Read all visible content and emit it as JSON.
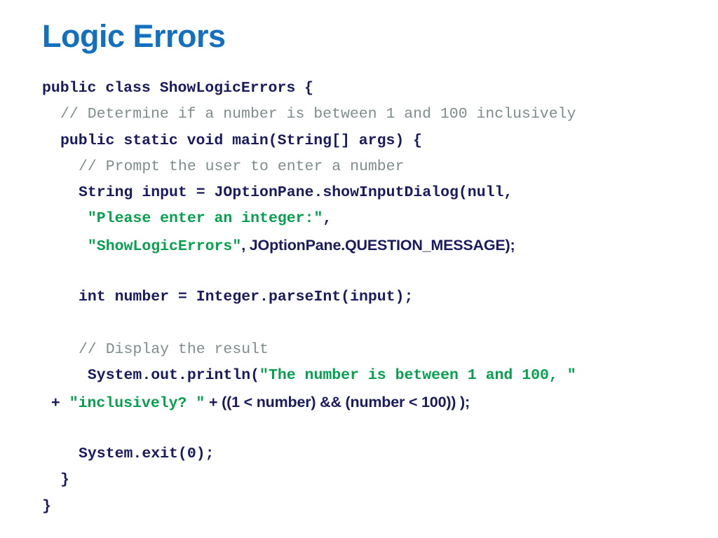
{
  "slide": {
    "title": "Logic Errors",
    "title_color": "#1270BE",
    "background_color": "#ffffff"
  },
  "colors": {
    "code": "#1A1A5E",
    "comment": "#7F8C8D",
    "string": "#06A04F",
    "title": "#1270BE"
  },
  "code": {
    "language": "java",
    "lines": [
      {
        "indent": 0,
        "tokens": [
          {
            "kind": "code",
            "text": "public class ShowLogicErrors {"
          }
        ]
      },
      {
        "indent": 1,
        "tokens": [
          {
            "kind": "comment",
            "text": "// Determine if a number is between 1 and 100 inclusively"
          }
        ]
      },
      {
        "indent": 1,
        "tokens": [
          {
            "kind": "code",
            "text": "public static void main(String[] args) {"
          }
        ]
      },
      {
        "indent": 2,
        "tokens": [
          {
            "kind": "comment",
            "text": "// Prompt the user to enter a number"
          }
        ]
      },
      {
        "indent": 2,
        "tokens": [
          {
            "kind": "code",
            "text": "String input = JOptionPane.showInputDialog(null,"
          }
        ]
      },
      {
        "indent": 2,
        "tokens": [
          {
            "kind": "string",
            "text": " \"Please enter an integer:\""
          },
          {
            "kind": "code",
            "text": ","
          }
        ]
      },
      {
        "indent": 2,
        "tokens": [
          {
            "kind": "string",
            "text": " \"ShowLogicErrors\""
          },
          {
            "kind": "alt",
            "text": ", JOptionPane.QUESTION_MESSAGE);"
          }
        ]
      },
      {
        "indent": 0,
        "blank": true,
        "tokens": []
      },
      {
        "indent": 2,
        "tokens": [
          {
            "kind": "code",
            "text": "int number = Integer.parseInt(input);"
          }
        ]
      },
      {
        "indent": 0,
        "blank": true,
        "tokens": []
      },
      {
        "indent": 2,
        "tokens": [
          {
            "kind": "comment",
            "text": "// Display the result"
          }
        ]
      },
      {
        "indent": 2,
        "tokens": [
          {
            "kind": "code",
            "text": " System.out.println("
          },
          {
            "kind": "string",
            "text": "\"The number is between 1 and 100, \""
          }
        ]
      },
      {
        "indent": 0,
        "tokens": [
          {
            "kind": "code",
            "text": " + "
          },
          {
            "kind": "string",
            "text": "\"inclusively? \""
          },
          {
            "kind": "alt",
            "text": " + ((1 < number) && (number < 100)) );"
          }
        ]
      },
      {
        "indent": 0,
        "blank": true,
        "tokens": []
      },
      {
        "indent": 2,
        "tokens": [
          {
            "kind": "code",
            "text": "System.exit(0);"
          }
        ]
      },
      {
        "indent": 1,
        "tokens": [
          {
            "kind": "code",
            "text": "}"
          }
        ]
      },
      {
        "indent": 0,
        "tokens": [
          {
            "kind": "code",
            "text": "}"
          }
        ]
      }
    ]
  }
}
